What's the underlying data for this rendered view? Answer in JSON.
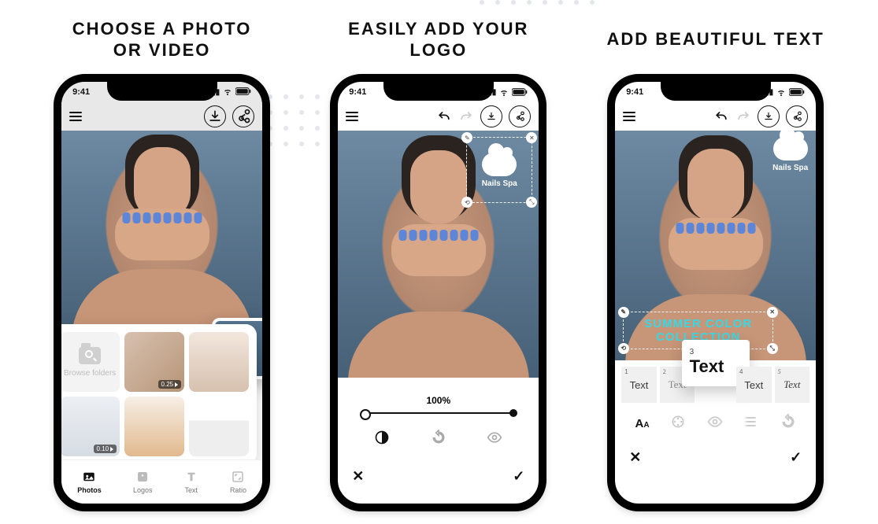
{
  "headings": {
    "panel1_line1": "CHOOSE A PHOTO",
    "panel1_line2": "OR VIDEO",
    "panel2_line1": "EASILY ADD YOUR",
    "panel2_line2": "LOGO",
    "panel3": "ADD BEAUTIFUL TEXT"
  },
  "status": {
    "time": "9:41"
  },
  "panel1": {
    "gallery": {
      "browse_label": "Browse folders",
      "items": [
        {
          "duration": "0.25"
        },
        {
          "duration": ""
        },
        {
          "duration": "0.10"
        },
        {
          "duration": ""
        },
        {
          "duration": ""
        }
      ]
    },
    "tabs": {
      "photos": "Photos",
      "logos": "Logos",
      "text": "Text",
      "ratio": "Ratio"
    }
  },
  "panel2": {
    "logo_text": "Nails Spa",
    "zoom_label": "100%"
  },
  "panel3": {
    "logo_text": "Nails Spa",
    "overlay_line1": "SUMMER COLOR",
    "overlay_line2": "COLLECTION",
    "popup_index": "3",
    "popup_label": "Text",
    "fonts": {
      "f1": {
        "index": "1",
        "label": "Text"
      },
      "f2": {
        "index": "2",
        "label": "Text"
      },
      "f4": {
        "index": "4",
        "label": "Text"
      },
      "f5": {
        "index": "5",
        "label": "Text"
      }
    }
  }
}
